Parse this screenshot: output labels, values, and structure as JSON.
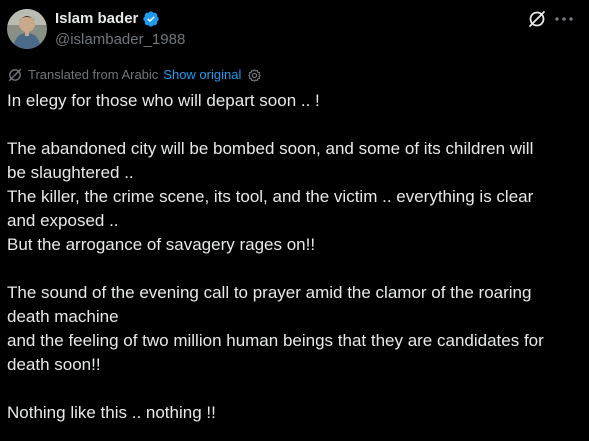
{
  "author": {
    "display_name": "Islam bader",
    "handle": "@islambader_1988",
    "verified_icon": "verified-badge-icon"
  },
  "header_actions": {
    "grok_icon": "grok-icon",
    "more_icon": "more-horizontal-icon"
  },
  "translation": {
    "label": "Translated from Arabic",
    "show_original": "Show original",
    "gear_icon": "settings-gear-icon"
  },
  "post": {
    "lines": [
      "In elegy for those who will depart soon .. !",
      "",
      "The abandoned city will be bombed soon, and some of its children will",
      "be slaughtered ..",
      "The killer, the crime scene, its tool, and the victim .. everything is clear",
      "and exposed ..",
      "But the arrogance of savagery rages on!!",
      "",
      "The sound of the evening call to prayer amid the clamor of the roaring",
      "death machine",
      "and the feeling of two million human beings that they are candidates for",
      "death soon!!",
      "",
      "Nothing like this .. nothing !!"
    ]
  },
  "colors": {
    "background": "#000000",
    "text_primary": "#e7e9ea",
    "text_secondary": "#71767b",
    "accent": "#1d9bf0"
  }
}
